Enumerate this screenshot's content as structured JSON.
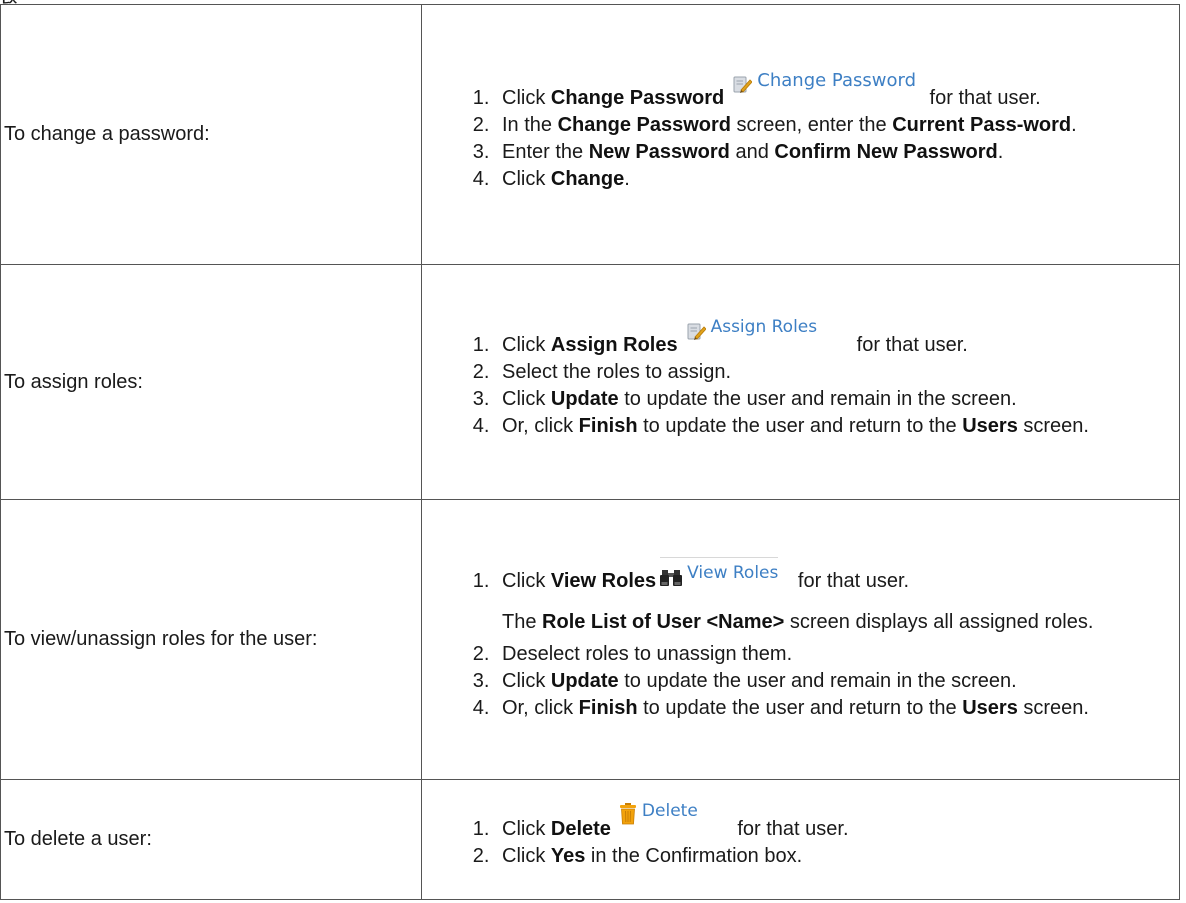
{
  "header_stub": "ﾭ",
  "rows": [
    {
      "task": "To change a password:",
      "steps": [
        {
          "a": "Click ",
          "b": "Change Password",
          "icon_label": "Change Password",
          "c": " for that user."
        },
        {
          "a": "In the ",
          "b": "Change Password",
          "c": " screen, enter the ",
          "d": "Current Pass-word",
          "e": "."
        },
        {
          "a": "Enter the ",
          "b": "New Password",
          "c": " and ",
          "d": "Confirm New Password",
          "e": "."
        },
        {
          "a": "Click ",
          "b": "Change",
          "c": "."
        }
      ]
    },
    {
      "task": "To assign roles:",
      "steps": [
        {
          "a": "Click ",
          "b": "Assign Roles",
          "icon_label": "Assign Roles",
          "c": " for that user."
        },
        {
          "a": "Select the roles to assign."
        },
        {
          "a": "Click ",
          "b": "Update",
          "c": " to update the user and remain in the screen."
        },
        {
          "a": "Or, click ",
          "b": "Finish",
          "c": " to update the user and return to the ",
          "d": "Users",
          "e": " screen."
        }
      ]
    },
    {
      "task": "To view/unassign roles for the user:",
      "steps": [
        {
          "a": "Click ",
          "b": "View Roles",
          "icon_label": "View Roles",
          "c": " for that user.",
          "note_b": "Role List of User <Name>",
          "note_c": " screen displays all assigned roles.",
          "note_a": "The "
        },
        {
          "a": "Deselect roles to unassign them."
        },
        {
          "a": "Click ",
          "b": "Update",
          "c": " to update the user and remain in the screen."
        },
        {
          "a": "Or, click ",
          "b": "Finish",
          "c": " to update the user and return to the ",
          "d": "Users",
          "e": " screen."
        }
      ]
    },
    {
      "task": "To delete a user:",
      "steps": [
        {
          "a": "Click ",
          "b": "Delete",
          "icon_label": "Delete",
          "c": " for that user."
        },
        {
          "a": "Click ",
          "b": "Yes",
          "c": " in the Confirmation box."
        }
      ]
    }
  ],
  "colors": {
    "link": "#3d7fc4",
    "border": "#555555",
    "pencil": "#e0a21b",
    "trash": "#f2a20c"
  },
  "icons": [
    "pencil-icon",
    "binoculars-icon",
    "trash-icon"
  ]
}
